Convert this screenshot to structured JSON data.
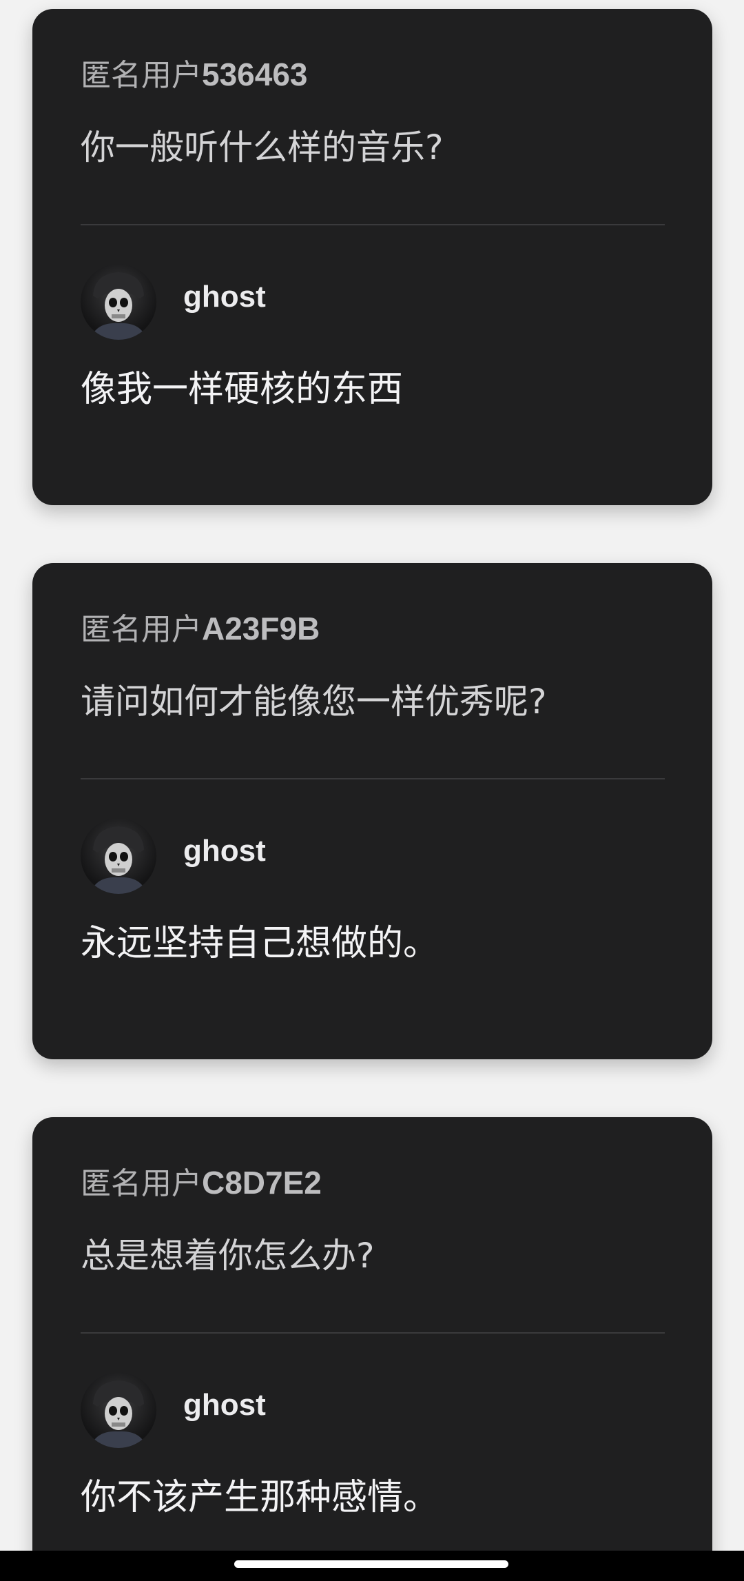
{
  "posts": [
    {
      "asker_prefix": "匿名用户",
      "asker_id": "536463",
      "question": "你一般听什么样的音乐?",
      "answerer": "ghost",
      "answer": "像我一样硬核的东西"
    },
    {
      "asker_prefix": "匿名用户",
      "asker_id": "A23F9B",
      "question": "请问如何才能像您一样优秀呢?",
      "answerer": "ghost",
      "answer": "永远坚持自己想做的。"
    },
    {
      "asker_prefix": "匿名用户",
      "asker_id": "C8D7E2",
      "question": "总是想着你怎么办?",
      "answerer": "ghost",
      "answer": "你不该产生那种感情。"
    }
  ],
  "colors": {
    "card_bg": "#1f1f20",
    "page_bg": "#f2f2f2",
    "asker_text": "#b2b2b4",
    "answer_text": "#f3f3f5"
  },
  "icons": {
    "avatar": "skull-mask-soldier-avatar"
  }
}
